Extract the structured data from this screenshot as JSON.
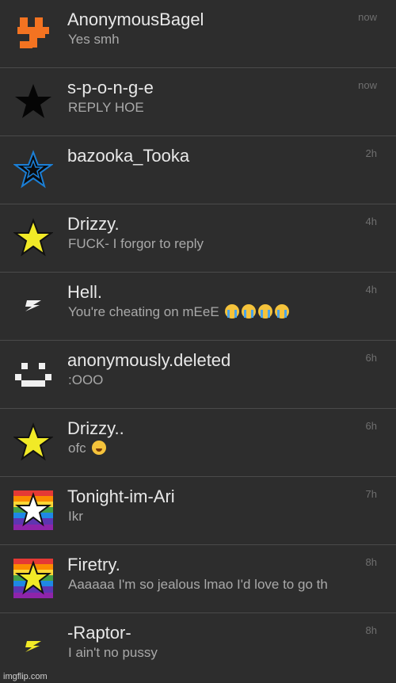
{
  "conversations": [
    {
      "name": "AnonymousBagel",
      "message": "Yes smh",
      "time": "now",
      "avatar": "orange-glyph-icon"
    },
    {
      "name": "s-p-o-n-g-e",
      "message": "REPLY HOE",
      "time": "now",
      "avatar": "black-star-icon"
    },
    {
      "name": "bazooka_Tooka",
      "message": "",
      "time": "2h",
      "avatar": "blue-outline-star-icon"
    },
    {
      "name": "Drizzy.",
      "message": "FUCK- I forgor to reply",
      "time": "4h",
      "avatar": "yellow-star-icon"
    },
    {
      "name": "Hell.",
      "message": "You're cheating on mEeE",
      "time": "4h",
      "avatar": "white-bolt-icon"
    },
    {
      "name": "anonymously.deleted",
      "message": ":OOO",
      "time": "6h",
      "avatar": "pixel-face-icon"
    },
    {
      "name": "Drizzy..",
      "message": "ofc",
      "time": "6h",
      "avatar": "yellow-star-icon"
    },
    {
      "name": "Tonight-im-Ari",
      "message": "Ikr",
      "time": "7h",
      "avatar": "rainbow-white-star-icon"
    },
    {
      "name": "Firetry.",
      "message": "Aaaaaa I'm so jealous lmao I'd love to go th",
      "time": "8h",
      "avatar": "rainbow-yellow-star-icon"
    },
    {
      "name": "-Raptor-",
      "message": "I ain't no pussy",
      "time": "8h",
      "avatar": "yellow-bolt-icon"
    }
  ],
  "watermark": "imgflip.com",
  "colors": {
    "background": "#2d2d2d",
    "divider": "#4a4a4a",
    "name": "#e8e8e8",
    "message": "#a9a9a9",
    "time": "#6f6f6f",
    "redaction": "#3c5f84"
  }
}
